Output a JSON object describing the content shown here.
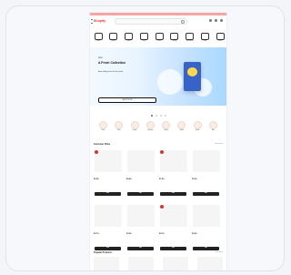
{
  "header": {
    "logo": "Shopify",
    "search_placeholder": "Search"
  },
  "categories": [
    {
      "label": "Pantry"
    },
    {
      "label": "Snacks"
    },
    {
      "label": "Frozen"
    },
    {
      "label": "Dairy"
    },
    {
      "label": "Drinks"
    },
    {
      "label": "Baking"
    },
    {
      "label": "Household"
    },
    {
      "label": "Baby"
    },
    {
      "label": "Health"
    }
  ],
  "hero": {
    "small_text": "NEW",
    "title": "A Fresh Collection",
    "subtitle": "Best selling items for the week",
    "cta": "SHOP NOW"
  },
  "promo": [
    {
      "label": "Deals"
    },
    {
      "label": "Fresh"
    },
    {
      "label": "Organic"
    },
    {
      "label": "Beverage"
    },
    {
      "label": "Bakery"
    },
    {
      "label": "Snacks"
    },
    {
      "label": "Bundle"
    },
    {
      "label": "More"
    }
  ],
  "section1": {
    "title": "Customer Picks",
    "view_all": "See more"
  },
  "products": [
    {
      "title": "Product",
      "price": "$2.99",
      "button": "Add"
    },
    {
      "title": "Product",
      "price": "$4.49",
      "button": "Add"
    },
    {
      "title": "Product",
      "price": "$1.99",
      "button": "Add"
    },
    {
      "title": "Product",
      "price": "$3.29",
      "button": "Add"
    },
    {
      "title": "Product",
      "price": "$2.79",
      "button": "Add"
    },
    {
      "title": "Product",
      "price": "$3.99",
      "button": "Add"
    },
    {
      "title": "Product",
      "price": "$5.19",
      "button": "Add"
    },
    {
      "title": "Product",
      "price": "$2.59",
      "button": "Add"
    }
  ],
  "section2": {
    "title": "Popular Products",
    "view_all": "See more"
  }
}
